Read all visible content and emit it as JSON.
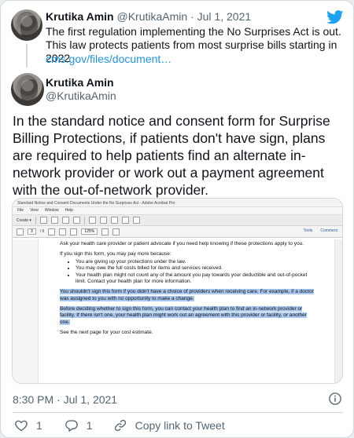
{
  "quoted": {
    "name": "Krutika Amin",
    "handle": "@KrutikaAmin",
    "separator": "·",
    "date": "Jul 1, 2021",
    "text": "The first regulation implementing the No Surprises Act is out. This law protects patients from most surprise bills starting in 2022",
    "link": "cms.gov/files/document…"
  },
  "author": {
    "name": "Krutika Amin",
    "handle": "@KrutikaAmin"
  },
  "tweet_text": "In the standard notice and consent form for Surprise Billing Protections, if patients don't have sign, plans are required to help patients find an alternate in-network provider or work out a payment agreement with the out-of-network provider.",
  "screenshot": {
    "window_title": "Standard Notice and Consent Documents Under the No Surprises Act - Adobe Acrobat Pro",
    "menu": [
      "File",
      "View",
      "Window",
      "Help"
    ],
    "create_label": "Create ▾",
    "page_current": "3",
    "page_total": "/ 6",
    "zoom": "125%",
    "tools_label": "Tools",
    "comment_label": "Comment",
    "p1": "Ask your health care provider or patient advocate if you need help knowing if these protections apply to you.",
    "p2": "If you sign this form, you may pay more because:",
    "bullets": [
      "You are giving up your protections under the law.",
      "You may owe the full costs billed for items and services received.",
      "Your health plan might not count any of the amount you pay towards your deductible and out-of-pocket limit. Contact your health plan for more information."
    ],
    "hl1": "You shouldn't sign this form if you didn't have a choice of providers when receiving care. For example, if a doctor was assigned to you with no opportunity to make a change.",
    "hl2": "Before deciding whether to sign this form, you can contact your health plan to find an in-network provider or facility. If there isn't one, your health plan might work out an agreement with this provider or facility, or another one.",
    "p3": "See the next page for your cost estimate."
  },
  "timestamp": {
    "time": "8:30 PM",
    "separator": "·",
    "date": "Jul 1, 2021"
  },
  "actions": {
    "likes": "1",
    "replies": "1",
    "share_label": "Copy link to Tweet"
  },
  "colors": {
    "link": "#1b95e0",
    "twitter_blue": "#1da1f2",
    "muted": "#536471",
    "highlight": "#a9c9f2"
  },
  "icons": [
    "twitter-bird-icon",
    "info-icon",
    "heart-icon",
    "reply-icon",
    "link-icon"
  ]
}
